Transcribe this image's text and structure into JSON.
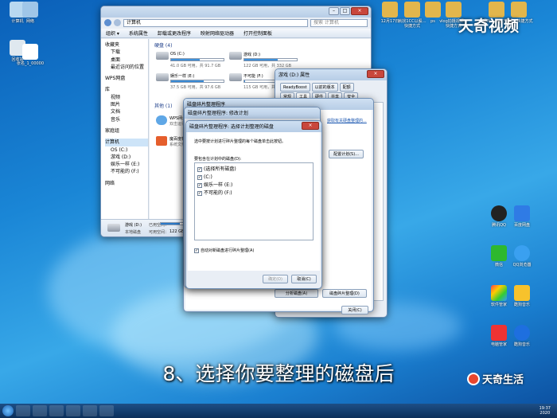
{
  "desktop": {
    "icons_left": [
      {
        "label": "计算机"
      },
      {
        "label": "网络"
      },
      {
        "label": "回收站"
      },
      {
        "label": "张名_1_00000"
      }
    ],
    "icons_top": [
      {
        "label": "12月17日"
      },
      {
        "label": "就找1CC以股…快捷方式"
      },
      {
        "label": "ps"
      },
      {
        "label": "vlog拍摄视频…快捷方式"
      },
      {
        "label": "新建文本文档"
      },
      {
        "label": "哪吒…快捷方式"
      },
      {
        "label": "看视…快捷方式"
      }
    ],
    "icons_right": [
      {
        "label": "腾讯QQ"
      },
      {
        "label": "百度网盘"
      },
      {
        "label": "微信"
      },
      {
        "label": "QQ浏览器"
      },
      {
        "label": "软件管家"
      },
      {
        "label": "酷狗音乐"
      },
      {
        "label": "电脑管家"
      },
      {
        "label": "酷狗音乐"
      }
    ]
  },
  "explorer": {
    "title": "计算机",
    "search_placeholder": "搜索 计算机",
    "toolbar": [
      "组织 ▾",
      "系统属性",
      "卸载或更改程序",
      "映射网络驱动器",
      "打开控制面板"
    ],
    "nav": [
      "收藏夹",
      "下载",
      "桌面",
      "最近访问的位置",
      "WPS网盘",
      "库",
      "视频",
      "图片",
      "文档",
      "音乐",
      "家庭组",
      "计算机",
      "OS (C:)",
      "游戏 (D:)",
      "娱乐一样 (E:)",
      "不可能的 (F:)",
      "网络"
    ],
    "group_hdd": "硬盘 (4)",
    "group_other": "其他 (1)",
    "drives": [
      {
        "name": "OS (C:)",
        "space": "41.0 GB 可用，共 91.7 GB",
        "fill": 0.55
      },
      {
        "name": "游戏 (D:)",
        "space": "122 GB 可用，共 332 GB",
        "fill": 0.63
      },
      {
        "name": "娱乐一样 (E:)",
        "space": "37.5 GB 可用，共 97.6 GB",
        "fill": 0.62
      },
      {
        "name": "不可能 (F:)",
        "space": "115 GB 可用，共 117 GB",
        "fill": 0.02
      }
    ],
    "other": [
      {
        "name": "WPS网盘",
        "desc": "双击运行WPS网盘"
      },
      {
        "name": "魔百度软件",
        "desc": "系统文件夹"
      }
    ],
    "status": {
      "name": "游戏 (D:)",
      "used_label": "已用空间：",
      "free_label": "可用空间：",
      "free": "122 GB",
      "type": "本地磁盘"
    }
  },
  "props": {
    "title": "游戏 (D:) 属性",
    "tabs_row1": [
      "ReadyBoost",
      "以前的版本",
      "配额"
    ],
    "tabs_row2": [
      "常规",
      "工具",
      "硬件",
      "共享",
      "安全"
    ],
    "link": "获取有关硬盘整理的...",
    "defrag_btn": "配置计划(S)...",
    "btn_analyze": "分析磁盘(A)",
    "btn_defrag": "磁盘碎片整理(D)",
    "close_btn": "关闭(C)"
  },
  "defrag": {
    "title": "磁盘碎片整理程序",
    "subtitle": "磁盘碎片整理程序: 修改计划"
  },
  "select": {
    "title": "磁盘碎片整理程序: 选择计划整理的磁盘",
    "desc": "选中要按计划进行碎片整理的每个磁盘单击此按钮。",
    "group": "要包含在计划中的磁盘(D):",
    "disks": [
      {
        "label": "(选择所有磁盘)",
        "checked": true
      },
      {
        "label": "(C:)",
        "checked": true
      },
      {
        "label": "娱乐一样 (E:)",
        "checked": true
      },
      {
        "label": "不可能的 (F:)",
        "checked": true
      }
    ],
    "auto_new": "自动对新磁盘进行碎片整理(A)",
    "ok": "确定(O)",
    "cancel": "取消(C)"
  },
  "caption": "8、选择你要整理的磁盘后",
  "watermark_top": "天奇视频",
  "watermark_bottom": "天奇生活",
  "clock": {
    "time": "19:37",
    "date": "2020"
  }
}
